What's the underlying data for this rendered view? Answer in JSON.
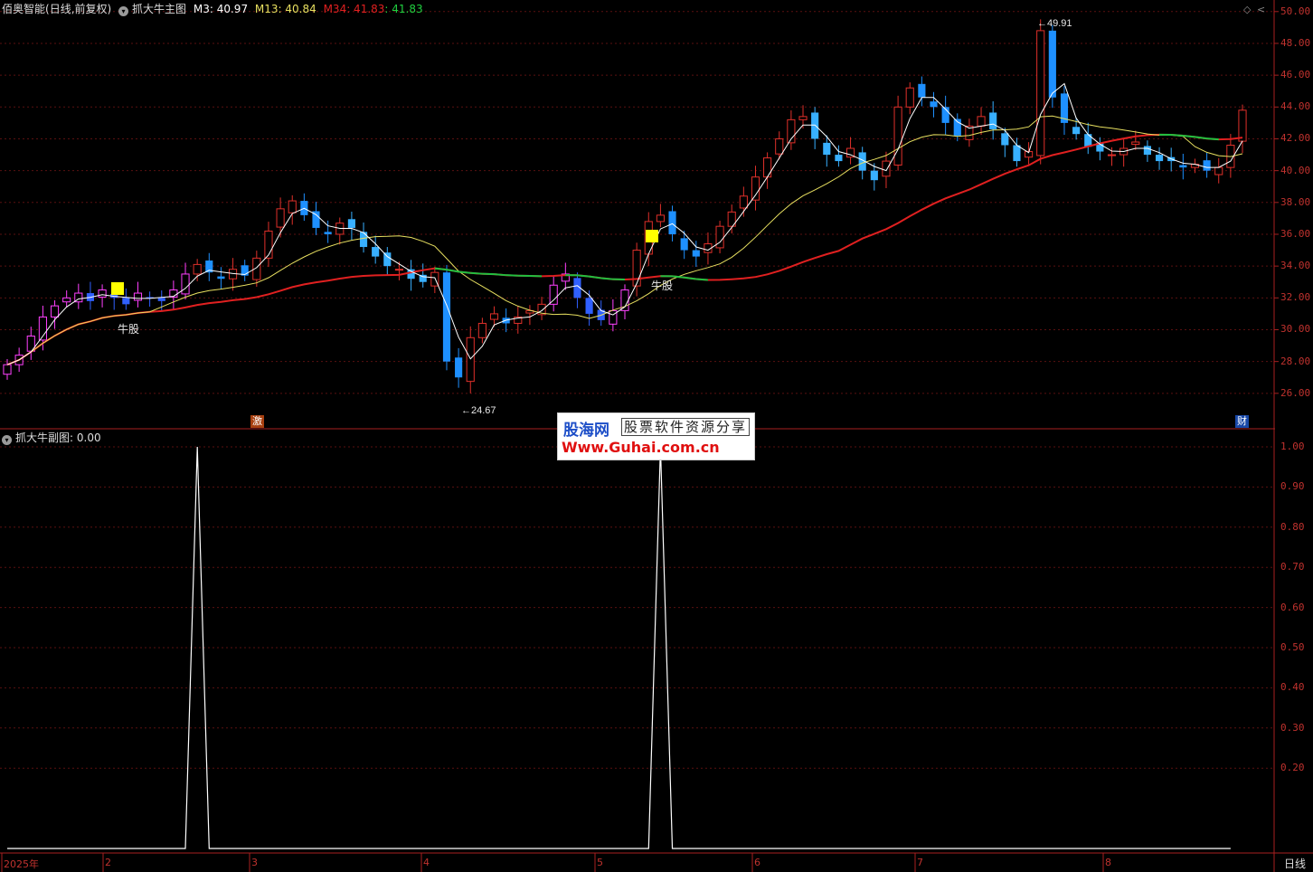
{
  "main_header": {
    "title": "佰奥智能",
    "period": "(日线,前复权)",
    "indicator": "抓大牛主图",
    "m3": "M3: 40.97",
    "m13": "M13: 40.84",
    "m34": "M34: 41.83",
    "m34b": ": 41.83"
  },
  "sub_header": {
    "indicator": "抓大牛副图",
    "value": ": 0.00"
  },
  "annotations": {
    "high": "49.91",
    "low": "24.67",
    "signal1": "牛股",
    "signal2": "牛股",
    "tag_left": "激",
    "tag_right": "财"
  },
  "main_axis": [
    "50.00",
    "48.00",
    "46.00",
    "44.00",
    "42.00",
    "40.00",
    "38.00",
    "36.00",
    "34.00",
    "32.00",
    "30.00",
    "28.00",
    "26.00"
  ],
  "sub_axis": [
    "1.00",
    "0.90",
    "0.80",
    "0.70",
    "0.60",
    "0.50",
    "0.40",
    "0.30",
    "0.20"
  ],
  "x_axis": [
    "2025年",
    "2",
    "3",
    "4",
    "5",
    "6",
    "7",
    "8"
  ],
  "period_label": "日线",
  "watermark": {
    "logo": "股海网",
    "slogan": "股票软件资源分享",
    "url": "Www.Guhai.com.cn"
  },
  "colors": {
    "up": "#e0302a",
    "down": "#1e90ff",
    "strong": "#ff40ff",
    "m3": "#ffffff",
    "m13": "#e8e060",
    "m34_up": "#e02020",
    "m34_down": "#20c040"
  },
  "chart_data": {
    "type": "candlestick",
    "price_range": [
      24.0,
      50.5
    ],
    "close_series": [
      27.8,
      28.4,
      29.6,
      30.8,
      31.5,
      32.0,
      32.3,
      31.8,
      32.5,
      32.0,
      31.6,
      32.3,
      32.0,
      31.8,
      32.5,
      33.5,
      34.1,
      33.6,
      33.2,
      33.8,
      33.4,
      34.5,
      36.2,
      37.6,
      38.1,
      37.2,
      36.4,
      36.0,
      36.7,
      36.4,
      35.2,
      34.6,
      34.0,
      33.8,
      33.2,
      33.0,
      33.6,
      28.0,
      27.0,
      29.5,
      30.4,
      31.0,
      30.4,
      30.8,
      31.2,
      31.6,
      32.8,
      33.5,
      32.0,
      31.0,
      30.6,
      31.2,
      32.5,
      35.0,
      36.8,
      37.2,
      36.0,
      35.0,
      34.6,
      35.4,
      36.5,
      37.4,
      38.4,
      39.6,
      40.8,
      42.0,
      43.2,
      43.4,
      42.0,
      41.0,
      40.6,
      41.4,
      40.0,
      39.4,
      40.6,
      44.0,
      45.2,
      44.6,
      44.0,
      43.0,
      42.2,
      42.8,
      43.4,
      42.6,
      41.6,
      40.6,
      41.2,
      48.8,
      44.6,
      43.0,
      42.3,
      41.5,
      41.2,
      41.0,
      41.4,
      41.8,
      41.0,
      40.6,
      40.6,
      40.2,
      40.4,
      40.0,
      40.2,
      41.6,
      43.8
    ],
    "subchart_signal": [
      0,
      0,
      0,
      0,
      0,
      0,
      0,
      0,
      0,
      0,
      0,
      0,
      0,
      0,
      0,
      0,
      1,
      0,
      0,
      0,
      0,
      0,
      0,
      0,
      0,
      0,
      0,
      0,
      0,
      0,
      0,
      0,
      0,
      0,
      0,
      0,
      0,
      0,
      0,
      0,
      0,
      0,
      0,
      0,
      0,
      0,
      0,
      0,
      0,
      0,
      0,
      0,
      0,
      0,
      0,
      1,
      0,
      0,
      0,
      0,
      0,
      0,
      0,
      0,
      0,
      0,
      0,
      0,
      0,
      0,
      0,
      0,
      0,
      0,
      0,
      0,
      0,
      0,
      0,
      0,
      0,
      0,
      0,
      0,
      0,
      0,
      0,
      0,
      0,
      0,
      0,
      0,
      0,
      0,
      0,
      0,
      0,
      0,
      0,
      0,
      0,
      0,
      0,
      0
    ]
  }
}
